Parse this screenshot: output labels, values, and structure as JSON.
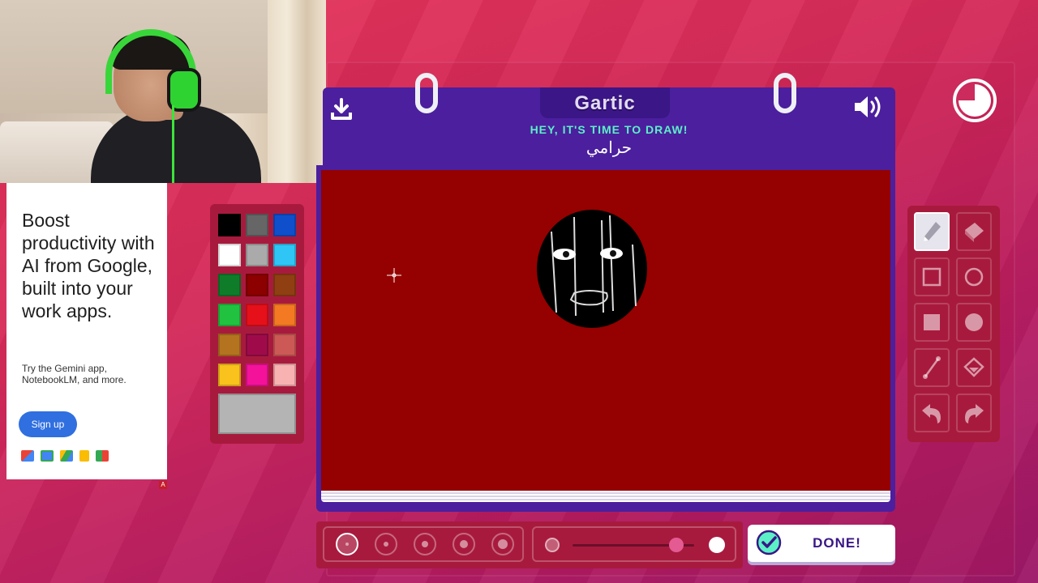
{
  "ad": {
    "headline": "Boost productivity with AI from Google, built into your work apps.",
    "subtext": "Try the Gemini app, NotebookLM, and more.",
    "signup_label": "Sign up",
    "badge": "A",
    "app_icons": [
      "gmail-icon",
      "calendar-icon",
      "drive-icon",
      "docs-icon",
      "meet-icon"
    ]
  },
  "header": {
    "logo": "Gartic",
    "prompt": "HEY, IT'S TIME TO DRAW!",
    "word": "حرامي"
  },
  "palette": {
    "colors": [
      "#000000",
      "#666666",
      "#0f4fcb",
      "#ffffff",
      "#aaaaaa",
      "#2fc6f5",
      "#0f7c2a",
      "#8c0000",
      "#8f3f12",
      "#22c241",
      "#e6101a",
      "#f37a22",
      "#b4731f",
      "#9f0b4a",
      "#cc5955",
      "#f9c21c",
      "#f4129a",
      "#f8b2b2"
    ],
    "current_color": "#b4b4b4"
  },
  "tools": [
    "pencil-tool",
    "eraser-tool",
    "rect-outline-tool",
    "ellipse-outline-tool",
    "rect-fill-tool",
    "ellipse-fill-tool",
    "line-tool",
    "fill-bucket-tool",
    "undo-tool",
    "redo-tool"
  ],
  "active_tool": "pencil-tool",
  "brush": {
    "sizes": [
      1,
      2,
      3,
      4,
      5
    ],
    "selected_size": 1,
    "opacity": 0.85
  },
  "done_label": "DONE!",
  "colors": {
    "header": "#4b1f9e",
    "canvas": "#950000",
    "prompt": "#5cf0c7",
    "panel": "#a81a3d"
  }
}
